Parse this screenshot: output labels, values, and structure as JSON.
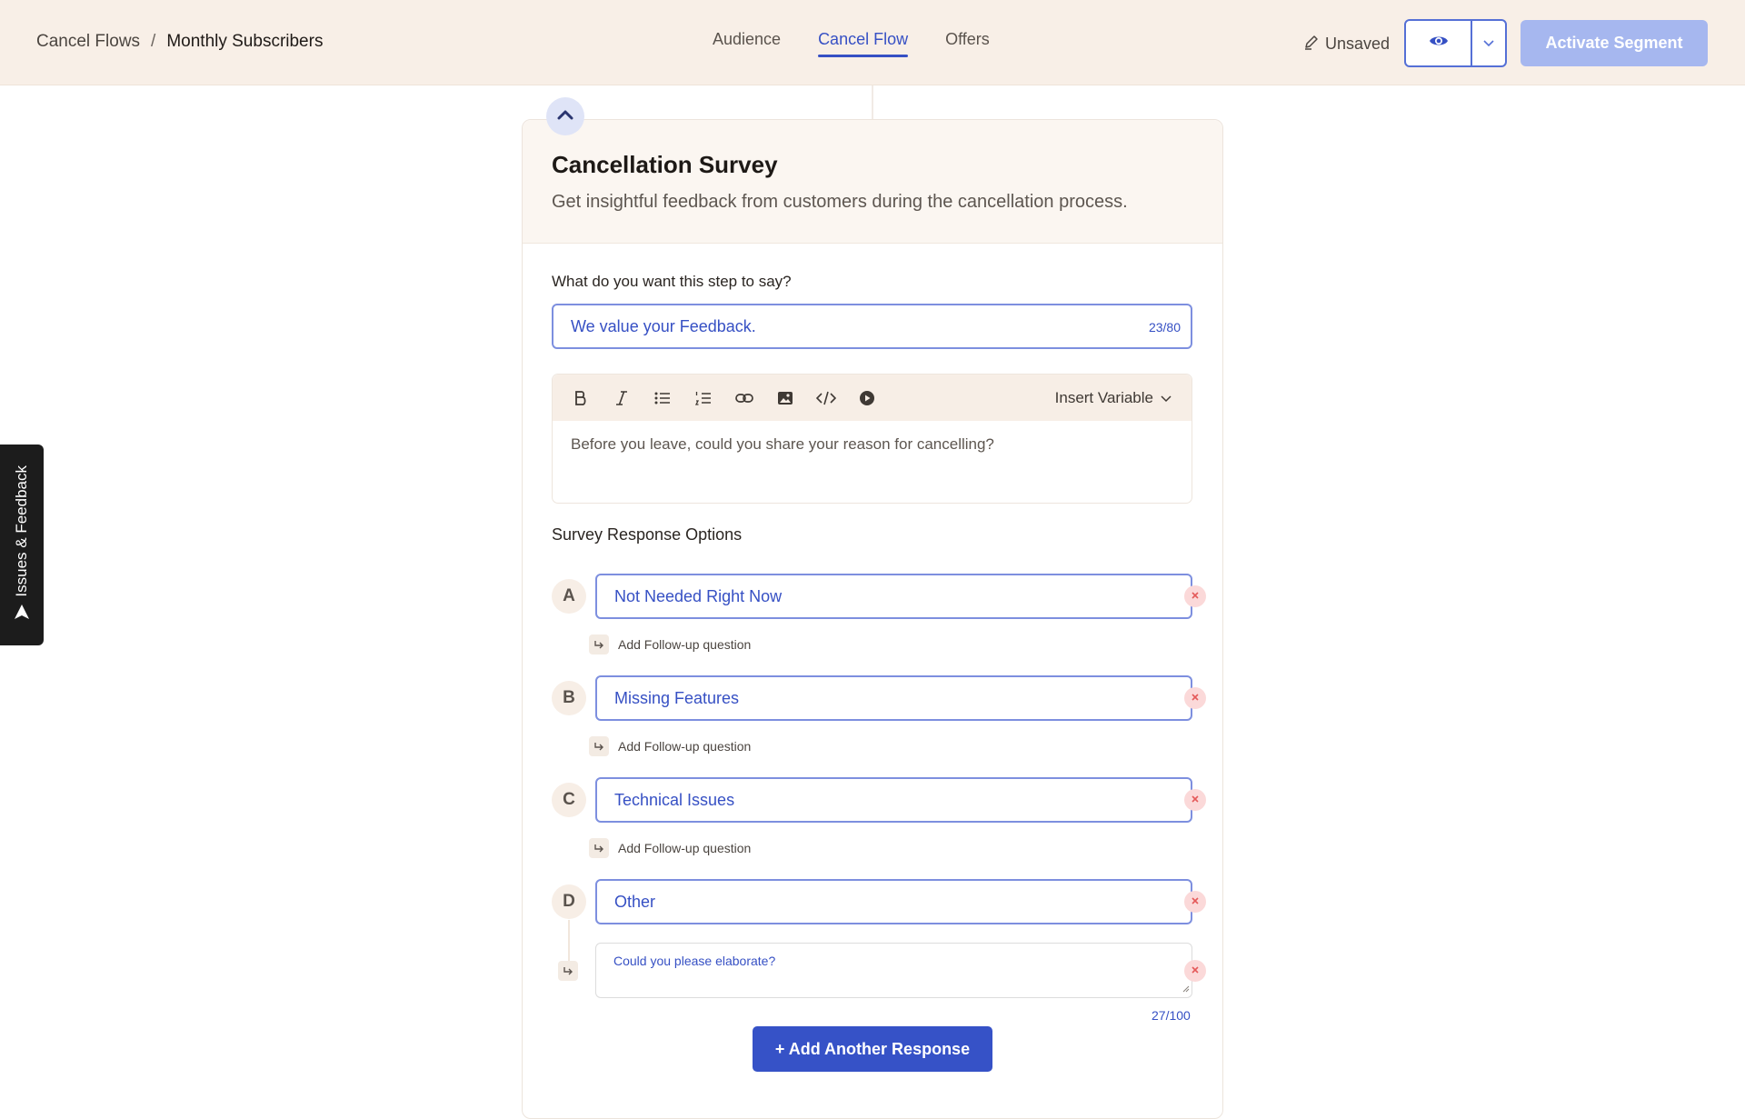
{
  "breadcrumb": {
    "parent": "Cancel Flows",
    "separator": "/",
    "current": "Monthly Subscribers"
  },
  "tabs": [
    {
      "label": "Audience",
      "active": false
    },
    {
      "label": "Cancel Flow",
      "active": true
    },
    {
      "label": "Offers",
      "active": false
    }
  ],
  "header": {
    "status": "Unsaved",
    "activate_label": "Activate Segment"
  },
  "side_tab": {
    "label": "Issues & Feedback"
  },
  "survey": {
    "title": "Cancellation Survey",
    "subtitle": "Get insightful feedback from customers during the cancellation process.",
    "step_label": "What do you want this step to say?",
    "step_value": "We value your Feedback.",
    "step_count": "23/80",
    "insert_variable": "Insert Variable",
    "body_text": "Before you leave, could you share your reason for cancelling?",
    "options_label": "Survey Response Options",
    "options": [
      {
        "letter": "A",
        "value": "Not Needed Right Now",
        "followup_label": "Add Follow-up question"
      },
      {
        "letter": "B",
        "value": "Missing Features",
        "followup_label": "Add Follow-up question"
      },
      {
        "letter": "C",
        "value": "Technical Issues",
        "followup_label": "Add Follow-up question"
      },
      {
        "letter": "D",
        "value": "Other"
      }
    ],
    "followup_text": "Could you please elaborate?",
    "followup_count": "27/100",
    "add_response_label": "+ Add Another Response"
  },
  "colors": {
    "accent": "#3650c4",
    "activate_disabled": "#a6b7ef",
    "header_bg": "#f8efe7",
    "remove": "#fbd9d9"
  }
}
